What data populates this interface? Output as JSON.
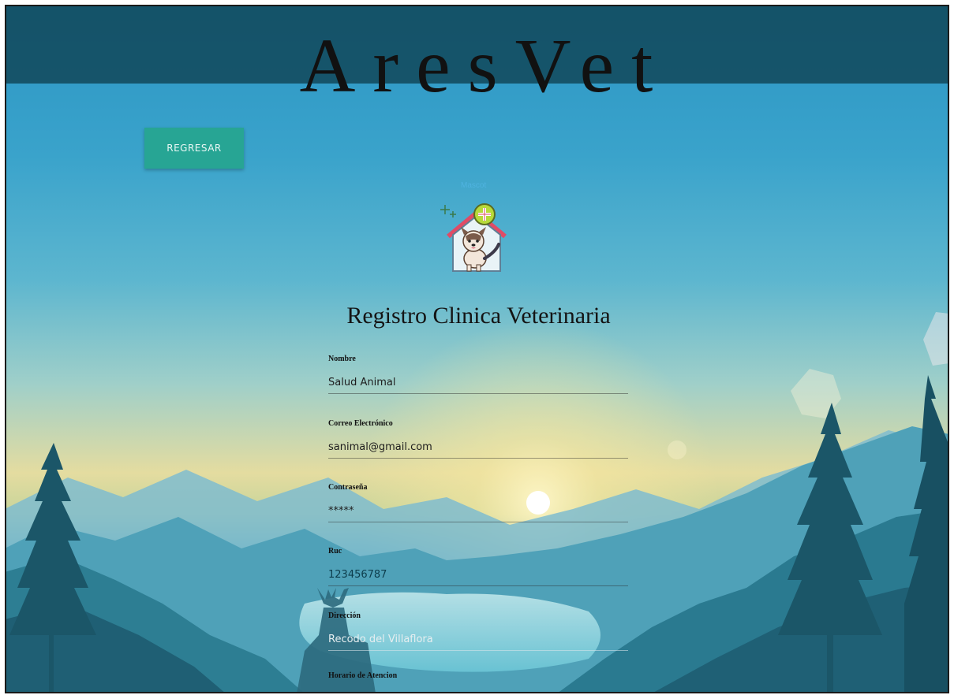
{
  "header": {
    "title": "AresVet"
  },
  "actions": {
    "back_label": "REGRESAR"
  },
  "logo": {
    "caption": "Mascot",
    "icon": "vet-clinic-house-dog-icon"
  },
  "form": {
    "title": "Registro Clinica Veterinaria",
    "fields": [
      {
        "label": "Nombre",
        "value": "Salud Animal",
        "type": "text"
      },
      {
        "label": "Correo Electrónico",
        "value": "sanimal@gmail.com",
        "type": "email"
      },
      {
        "label": "Contraseña",
        "value": "*****",
        "type": "password"
      },
      {
        "label": "Ruc",
        "value": "123456787",
        "type": "text"
      },
      {
        "label": "Dirección",
        "value": "Recodo del Villaflora",
        "type": "text"
      },
      {
        "label": "Horario de Atencion",
        "value": "",
        "type": "text"
      }
    ]
  },
  "colors": {
    "header_band": "#0e4050",
    "button": "#27a594",
    "sky_top": "#2b95c4",
    "horizon": "#e4dca0",
    "forest": "#1f6f86"
  }
}
